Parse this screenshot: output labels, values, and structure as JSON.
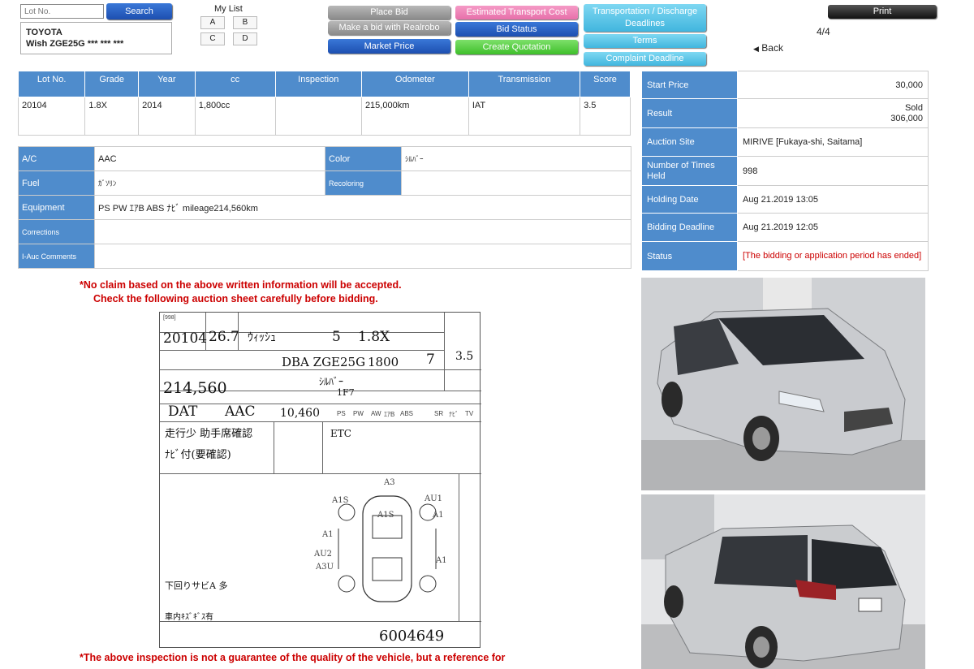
{
  "top": {
    "lot_placeholder": "Lot No.",
    "search_label": "Search",
    "car_make": "TOYOTA",
    "car_model": "Wish ZGE25G *** *** ***",
    "mylist_label": "My List",
    "mylist_options": [
      "A",
      "B",
      "C",
      "D"
    ],
    "buttons": {
      "place_bid": "Place Bid",
      "make_bid_realrobo": "Make a bid with Realrobo",
      "market_price": "Market Price",
      "estimated_transport": "Estimated Transport Cost",
      "bid_status": "Bid Status",
      "create_quotation": "Create Quotation",
      "transport_deadlines": "Transportation / Discharge Deadlines",
      "terms": "Terms",
      "complaint_deadline": "Complaint Deadline",
      "print": "Print"
    },
    "page_counter": "4/4",
    "back_label": "Back"
  },
  "spec": {
    "headers": [
      "Lot No.",
      "Grade",
      "Year",
      "cc",
      "Inspection",
      "Odometer",
      "Transmission",
      "Score"
    ],
    "values": [
      "20104",
      "1.8X",
      "2014",
      "1,800cc",
      "",
      "215,000km",
      "IAT",
      "3.5"
    ]
  },
  "details": {
    "ac_label": "A/C",
    "ac_value": "AAC",
    "color_label": "Color",
    "color_value": "ｼﾙﾊﾞｰ",
    "fuel_label": "Fuel",
    "fuel_value": "ｶﾞｿﾘﾝ",
    "recoloring_label": "Recoloring",
    "recoloring_value": "",
    "equipment_label": "Equipment",
    "equipment_value": "PS PW ｴｱB ABS ﾅﾋﾞ mileage214,560km",
    "corrections_label": "Corrections",
    "corrections_value": "",
    "comments_label": "I-Auc Comments",
    "comments_value": ""
  },
  "info": {
    "start_price_label": "Start Price",
    "start_price": "30,000",
    "result_label": "Result",
    "result_status": "Sold",
    "result_price": "306,000",
    "site_label": "Auction Site",
    "site_value": "MIRIVE [Fukaya-shi, Saitama]",
    "times_label": "Number of Times Held",
    "times_value": "998",
    "holding_label": "Holding Date",
    "holding_value": "Aug 21.2019 13:05",
    "deadline_label": "Bidding Deadline",
    "deadline_value": "Aug 21.2019 12:05",
    "status_label": "Status",
    "status_value": "[The bidding or application period has ended]"
  },
  "notes": {
    "claim_line1": "*No claim based on the above written information will be accepted.",
    "claim_line2": "Check the following auction sheet carefully before bidding.",
    "bottom_note": "*The above inspection is not a guarantee of the quality of the vehicle, but a reference for"
  },
  "sheet": {
    "auction_no": "[998]",
    "lot": "20104",
    "year": "26.7",
    "model": "ｳｨｯｼｭ",
    "doors": "5",
    "grade": "1.8X",
    "chassis": "DBA ZGE25G",
    "cc": "1800",
    "seats": "7",
    "score": "3.5",
    "mileage": "214,560",
    "color": "ｼﾙﾊﾞｰ",
    "color_code": "1F7",
    "trans": "DAT",
    "ac": "AAC",
    "recycle": "10,460",
    "equip": [
      "PS",
      "PW",
      "AW",
      "ｴｱB",
      "ABS",
      "SR",
      "ﾅﾋﾞ",
      "TV"
    ],
    "notes1": "走行少 助手席確認",
    "notes2": "ﾅﾋﾞ付(要確認)",
    "etc": "ETC",
    "damage_marks": [
      "A1S",
      "AU1",
      "A1S",
      "A3",
      "A1",
      "A1",
      "AU2",
      "A3U",
      "A1"
    ],
    "bottom_handwriting": "下回りサビA 多",
    "bottom_handwriting2": "車内ｷｽﾞｷﾞｽ有",
    "serial": "6004649"
  },
  "colors": {
    "header_blue": "#4f8ccc",
    "warning_red": "#cc0000"
  }
}
